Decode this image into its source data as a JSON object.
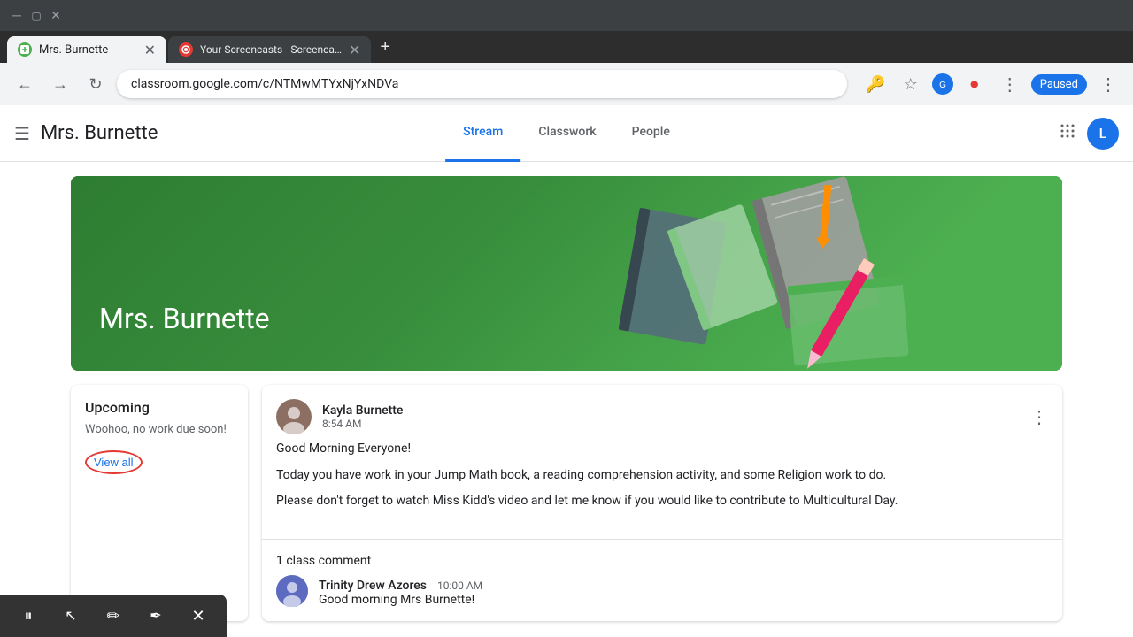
{
  "browser": {
    "tabs": [
      {
        "id": "tab1",
        "title": "Mrs. Burnette",
        "active": true,
        "favicon_color": "#4caf50"
      },
      {
        "id": "tab2",
        "title": "Your Screencasts - Screencastify",
        "active": false,
        "favicon_color": "#e53935"
      }
    ],
    "url": "classroom.google.com/c/NTMwMTYxNjYxNDVa",
    "paused_label": "Paused"
  },
  "header": {
    "title": "Mrs. Burnette",
    "menu_icon": "☰",
    "nav": [
      {
        "id": "stream",
        "label": "Stream",
        "active": true
      },
      {
        "id": "classwork",
        "label": "Classwork",
        "active": false
      },
      {
        "id": "people",
        "label": "People",
        "active": false
      }
    ],
    "user_initial": "L"
  },
  "hero": {
    "title": "Mrs. Burnette"
  },
  "upcoming": {
    "title": "Upcoming",
    "empty_text": "Woohoo, no work due soon!",
    "view_all_label": "View all"
  },
  "post": {
    "author": "Kayla Burnette",
    "time": "8:54 AM",
    "greeting": "Good Morning Everyone!",
    "body1": "Today you have work in your Jump Math book, a reading comprehension activity, and some Religion work to do.",
    "body2": "Please don't forget to watch Miss Kidd's video and let me know if you would like to contribute to Multicultural Day.",
    "comment_count": "1 class comment",
    "comment": {
      "author": "Trinity Drew Azores",
      "time": "10:00 AM",
      "text": "Good morning Mrs Burnette!"
    }
  },
  "screencast": {
    "pause_icon": "⏸",
    "cursor_icon": "↖",
    "pen_icon": "✏",
    "marker_icon": "✒",
    "close_icon": "✕"
  }
}
